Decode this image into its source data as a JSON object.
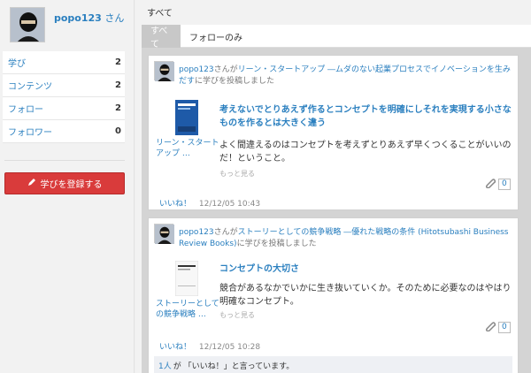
{
  "profile": {
    "username": "popo123",
    "honorific": "さん"
  },
  "stats": [
    {
      "label": "学び",
      "count": "2"
    },
    {
      "label": "コンテンツ",
      "count": "2"
    },
    {
      "label": "フォロー",
      "count": "2"
    },
    {
      "label": "フォロワー",
      "count": "0"
    }
  ],
  "register_button": {
    "icon": "pencil-icon",
    "label": "学びを登録する"
  },
  "section_title": "すべて",
  "tabs": [
    {
      "label": "すべて",
      "active": true
    },
    {
      "label": "フォローのみ",
      "active": false
    }
  ],
  "posts": [
    {
      "user": "popo123",
      "pre": "さんが",
      "book_link": "リーン・スタートアップ ―ムダのない起業プロセスでイノベーションを生みだす",
      "post": "に学びを投稿しました",
      "cover_caption": "リーン・スタート アップ …",
      "quote_title": "考えないでとりあえず作るとコンセプトを明確にしそれを実現する小さなものを作るとは大きく違う",
      "quote_body": "よく間違えるのはコンセプトを考えずとりあえず早くつくることがいいのだ！ということ。",
      "more": "もっと見る",
      "clip_count": "0",
      "like": "いいね！",
      "timestamp": "12/12/05 10:43"
    },
    {
      "user": "popo123",
      "pre": "さんが",
      "book_link": "ストーリーとしての競争戦略 ―優れた戦略の条件 (Hitotsubashi Business Review Books)",
      "post": "に学びを投稿しました",
      "cover_caption": "ストーリーとしての競争戦略 …",
      "quote_title": "コンセプトの大切さ",
      "quote_body": "競合があるなかでいかに生き抜いていくか。そのために必要なのはやはり明確なコンセプト。",
      "more": "もっと見る",
      "clip_count": "0",
      "like": "いいね！",
      "timestamp": "12/12/05 10:28",
      "liked_count": "1人",
      "liked_text": "が 「いいね！」と言っています。"
    }
  ],
  "colors": {
    "accent": "#2a7fbf",
    "register": "#d93b3b",
    "tab_active": "#c8c8c8"
  }
}
